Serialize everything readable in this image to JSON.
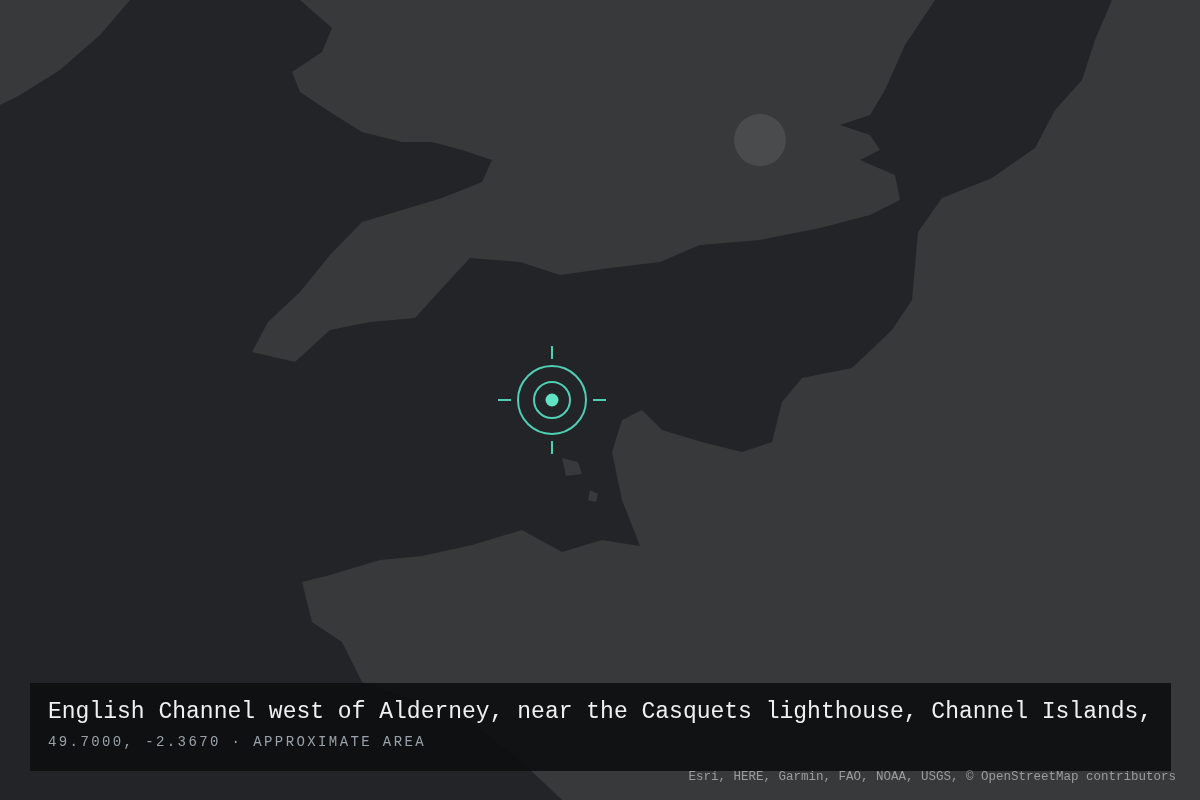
{
  "caption": {
    "title": "English Channel west of Alderney, near the Casquets lighthouse, Channel Islands,",
    "subtitle": "49.7000, -2.3670 · APPROXIMATE AREA"
  },
  "attribution": "Esri, HERE, Garmin, FAO, NOAA, USGS, © OpenStreetMap contributors"
}
